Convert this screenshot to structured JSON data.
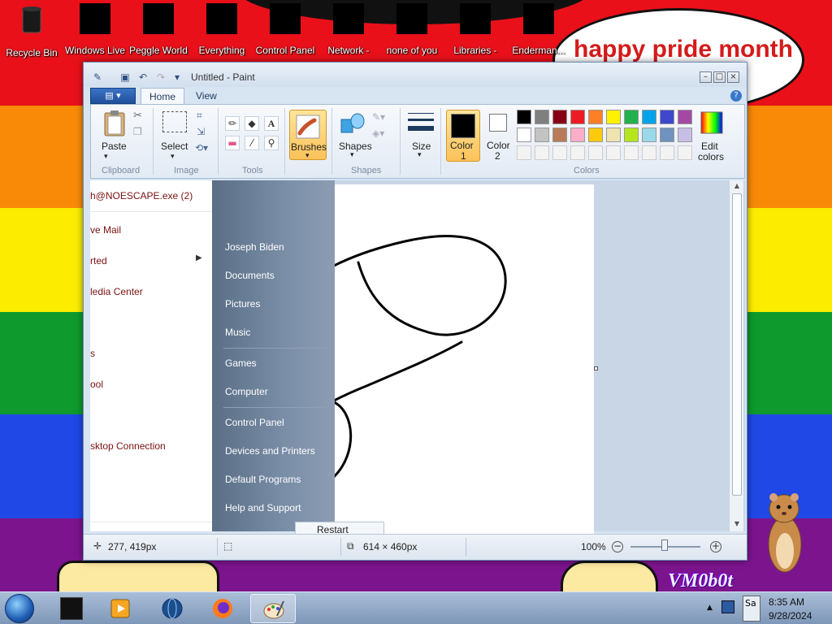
{
  "desktop": {
    "icons": [
      {
        "label": "Recycle Bin"
      },
      {
        "label": "Windows Live"
      },
      {
        "label": "Peggle World"
      },
      {
        "label": "Everything"
      },
      {
        "label": "Control Panel"
      },
      {
        "label": "Network -"
      },
      {
        "label": "none of you"
      },
      {
        "label": "Libraries -"
      },
      {
        "label": "Enderman..."
      }
    ],
    "speech_text": "happy pride month",
    "watermark": "VM0b0t",
    "stripe_colors": [
      "#e9101a",
      "#f88a08",
      "#fbec00",
      "#0e9a2c",
      "#1f48e6",
      "#7c148e"
    ]
  },
  "paint": {
    "title": "Untitled - Paint",
    "tabs": [
      "Home",
      "View"
    ],
    "clipboard": {
      "paste": "Paste",
      "group": "Clipboard"
    },
    "image": {
      "select": "Select",
      "group": "Image"
    },
    "tools": {
      "group": "Tools"
    },
    "brushes": {
      "label": "Brushes"
    },
    "shapes": {
      "label": "Shapes",
      "group": "Shapes"
    },
    "size": {
      "label": "Size"
    },
    "colors": {
      "color1_line1": "Color",
      "color1_line2": "1",
      "color2_line1": "Color",
      "color2_line2": "2",
      "edit_line1": "Edit",
      "edit_line2": "colors",
      "group": "Colors",
      "palette_row1": [
        "#000000",
        "#7f7f7f",
        "#880015",
        "#ed1c24",
        "#ff7f27",
        "#fff200",
        "#22b14c",
        "#00a2e8",
        "#3f48cc",
        "#a349a4"
      ],
      "palette_row2": [
        "#ffffff",
        "#c3c3c3",
        "#b97a57",
        "#ffaec9",
        "#ffc90e",
        "#efe4b0",
        "#b5e61d",
        "#99d9ea",
        "#7092be",
        "#c8bfe7"
      ],
      "color1": "#000000",
      "color2": "#ffffff"
    },
    "status": {
      "cursor_pos": "277, 419px",
      "image_size": "614 × 460px",
      "zoom": "100%"
    }
  },
  "start_menu": {
    "left_items": [
      "h@NOESCAPE.exe (2)",
      "ve Mail",
      "rted",
      "ledia Center",
      "s",
      "ool",
      "sktop Connection"
    ],
    "right_items": [
      "Joseph Biden",
      "Documents",
      "Pictures",
      "Music",
      "Games",
      "Computer",
      "Control Panel",
      "Devices and Printers",
      "Default Programs",
      "Help and Support"
    ],
    "restart": "Restart"
  },
  "taskbar": {
    "time": "8:35 AM",
    "date": "9/28/2024",
    "tray_label": "Sa"
  }
}
